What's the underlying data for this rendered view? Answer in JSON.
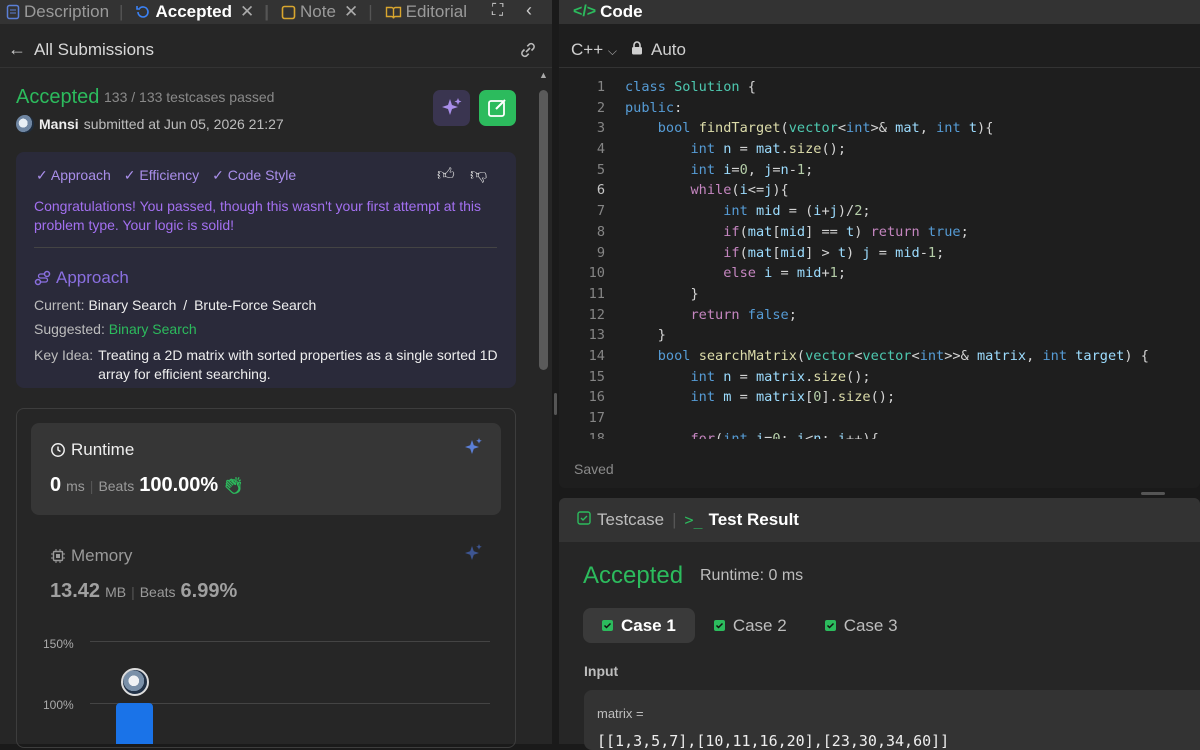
{
  "tabs": [
    {
      "label": "Description",
      "icon": "description-icon"
    },
    {
      "label": "Accepted",
      "icon": "history-icon"
    },
    {
      "label": "Note",
      "icon": "note-icon"
    },
    {
      "label": "Editorial",
      "icon": "book-icon"
    }
  ],
  "subheader": {
    "back_label": "All Submissions"
  },
  "submission": {
    "status": "Accepted",
    "testcases": "133 / 133 testcases passed",
    "user": "Mansi",
    "submitted": "submitted at Jun 05, 2026 21:27"
  },
  "feedback": {
    "tags": [
      "Approach",
      "Efficiency",
      "Code Style"
    ],
    "message": "Congratulations! You passed, though this wasn't your first attempt at this problem type. Your logic is solid!",
    "approach_title": "Approach",
    "current_label": "Current:",
    "current_value_1": "Binary Search",
    "current_sep": "/",
    "current_value_2": "Brute-Force Search",
    "suggested_label": "Suggested:",
    "suggested_value": "Binary Search",
    "key_idea_label": "Key Idea:",
    "key_idea_value": "Treating a 2D matrix with sorted properties as a single sorted 1D array for efficient searching."
  },
  "runtime": {
    "title": "Runtime",
    "value": "0",
    "unit": "ms",
    "beats_label": "Beats",
    "beats_value": "100.00%"
  },
  "memory": {
    "title": "Memory",
    "value": "13.42",
    "unit": "MB",
    "beats_label": "Beats",
    "beats_value": "6.99%"
  },
  "chart_data": {
    "type": "bar",
    "y_tick_labels": [
      "150%",
      "100%"
    ],
    "values": [
      100
    ]
  },
  "code": {
    "title": "Code",
    "language": "C++",
    "mode": "Auto",
    "status": "Saved",
    "current_line": 6
  },
  "testresult": {
    "testcase_tab": "Testcase",
    "result_tab": "Test Result",
    "status": "Accepted",
    "runtime": "Runtime: 0 ms",
    "cases": [
      "Case 1",
      "Case 2",
      "Case 3"
    ],
    "input_label": "Input",
    "param_name": "matrix =",
    "param_value": "[[1,3,5,7],[10,11,16,20],[23,30,34,60]]"
  },
  "colors": {
    "accent_green": "#2cbb5d",
    "purple": "#a370f0",
    "blue": "#1a73e8"
  }
}
